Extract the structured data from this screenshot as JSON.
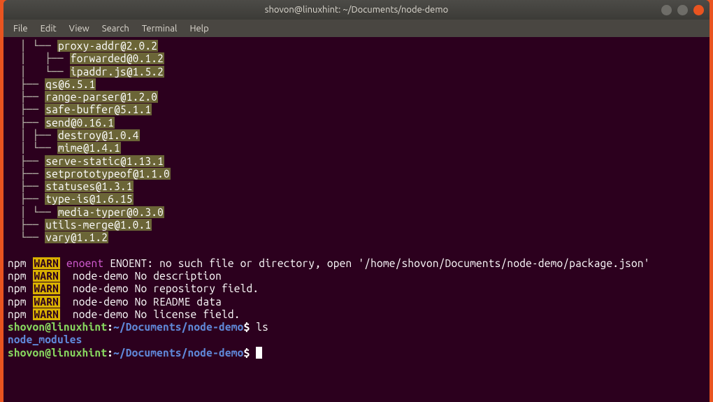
{
  "titlebar": {
    "title": "shovon@linuxhint: ~/Documents/node-demo"
  },
  "menubar": {
    "items": [
      "File",
      "Edit",
      "View",
      "Search",
      "Terminal",
      "Help"
    ]
  },
  "tree": {
    "lines": [
      {
        "prefix": "  │ └── ",
        "name": "proxy-addr@2.0.2"
      },
      {
        "prefix": "  │   ├── ",
        "name": "forwarded@0.1.2"
      },
      {
        "prefix": "  │   └── ",
        "name": "ipaddr.js@1.5.2"
      },
      {
        "prefix": "  ├── ",
        "name": "qs@6.5.1"
      },
      {
        "prefix": "  ├── ",
        "name": "range-parser@1.2.0"
      },
      {
        "prefix": "  ├── ",
        "name": "safe-buffer@5.1.1"
      },
      {
        "prefix": "  ├── ",
        "name": "send@0.16.1"
      },
      {
        "prefix": "  │ ├── ",
        "name": "destroy@1.0.4"
      },
      {
        "prefix": "  │ └── ",
        "name": "mime@1.4.1"
      },
      {
        "prefix": "  ├── ",
        "name": "serve-static@1.13.1"
      },
      {
        "prefix": "  ├── ",
        "name": "setprototypeof@1.1.0"
      },
      {
        "prefix": "  ├── ",
        "name": "statuses@1.3.1"
      },
      {
        "prefix": "  ├── ",
        "name": "type-is@1.6.15"
      },
      {
        "prefix": "  │ └── ",
        "name": "media-typer@0.3.0"
      },
      {
        "prefix": "  ├── ",
        "name": "utils-merge@1.0.1"
      },
      {
        "prefix": "  └── ",
        "name": "vary@1.1.2"
      }
    ]
  },
  "warnings": {
    "npm_label": "npm",
    "warn_label": "WARN",
    "lines": [
      {
        "tag": "enoent",
        "text": " ENOENT: no such file or directory, open '/home/shovon/Documents/node-demo/package.json'"
      },
      {
        "tag": "",
        "text": " node-demo No description"
      },
      {
        "tag": "",
        "text": " node-demo No repository field."
      },
      {
        "tag": "",
        "text": " node-demo No README data"
      },
      {
        "tag": "",
        "text": " node-demo No license field."
      }
    ]
  },
  "prompt": {
    "user": "shovon@linuxhint",
    "colon": ":",
    "path": "~/Documents/node-demo",
    "symbol": "$ "
  },
  "commands": {
    "ls": "ls",
    "ls_output": "node_modules"
  }
}
